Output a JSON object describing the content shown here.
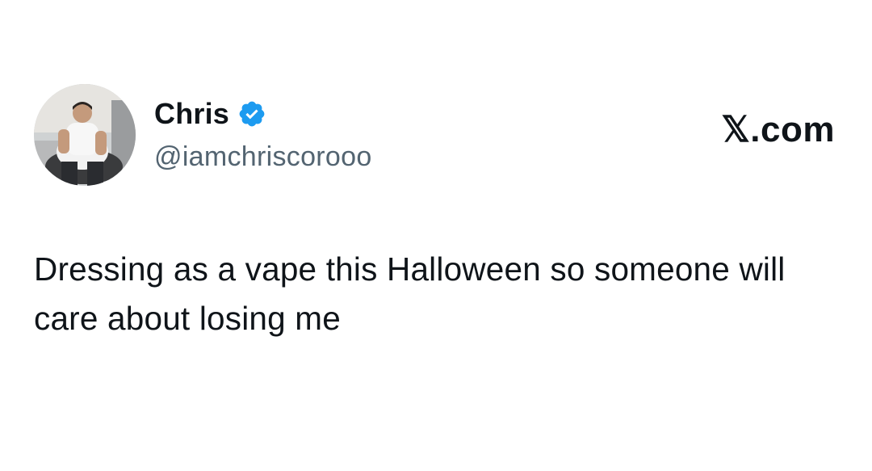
{
  "author": {
    "display_name": "Chris",
    "handle": "@iamchriscorooo",
    "verified": true,
    "verified_badge_color": "#1d9bf0",
    "avatar_icon": "profile-photo"
  },
  "platform": {
    "logo_text": "𝕏.com"
  },
  "tweet": {
    "text": "Dressing as a vape this Halloween so someone will care about losing me"
  },
  "colors": {
    "text_primary": "#0f1419",
    "text_secondary": "#536471",
    "background": "#ffffff"
  }
}
